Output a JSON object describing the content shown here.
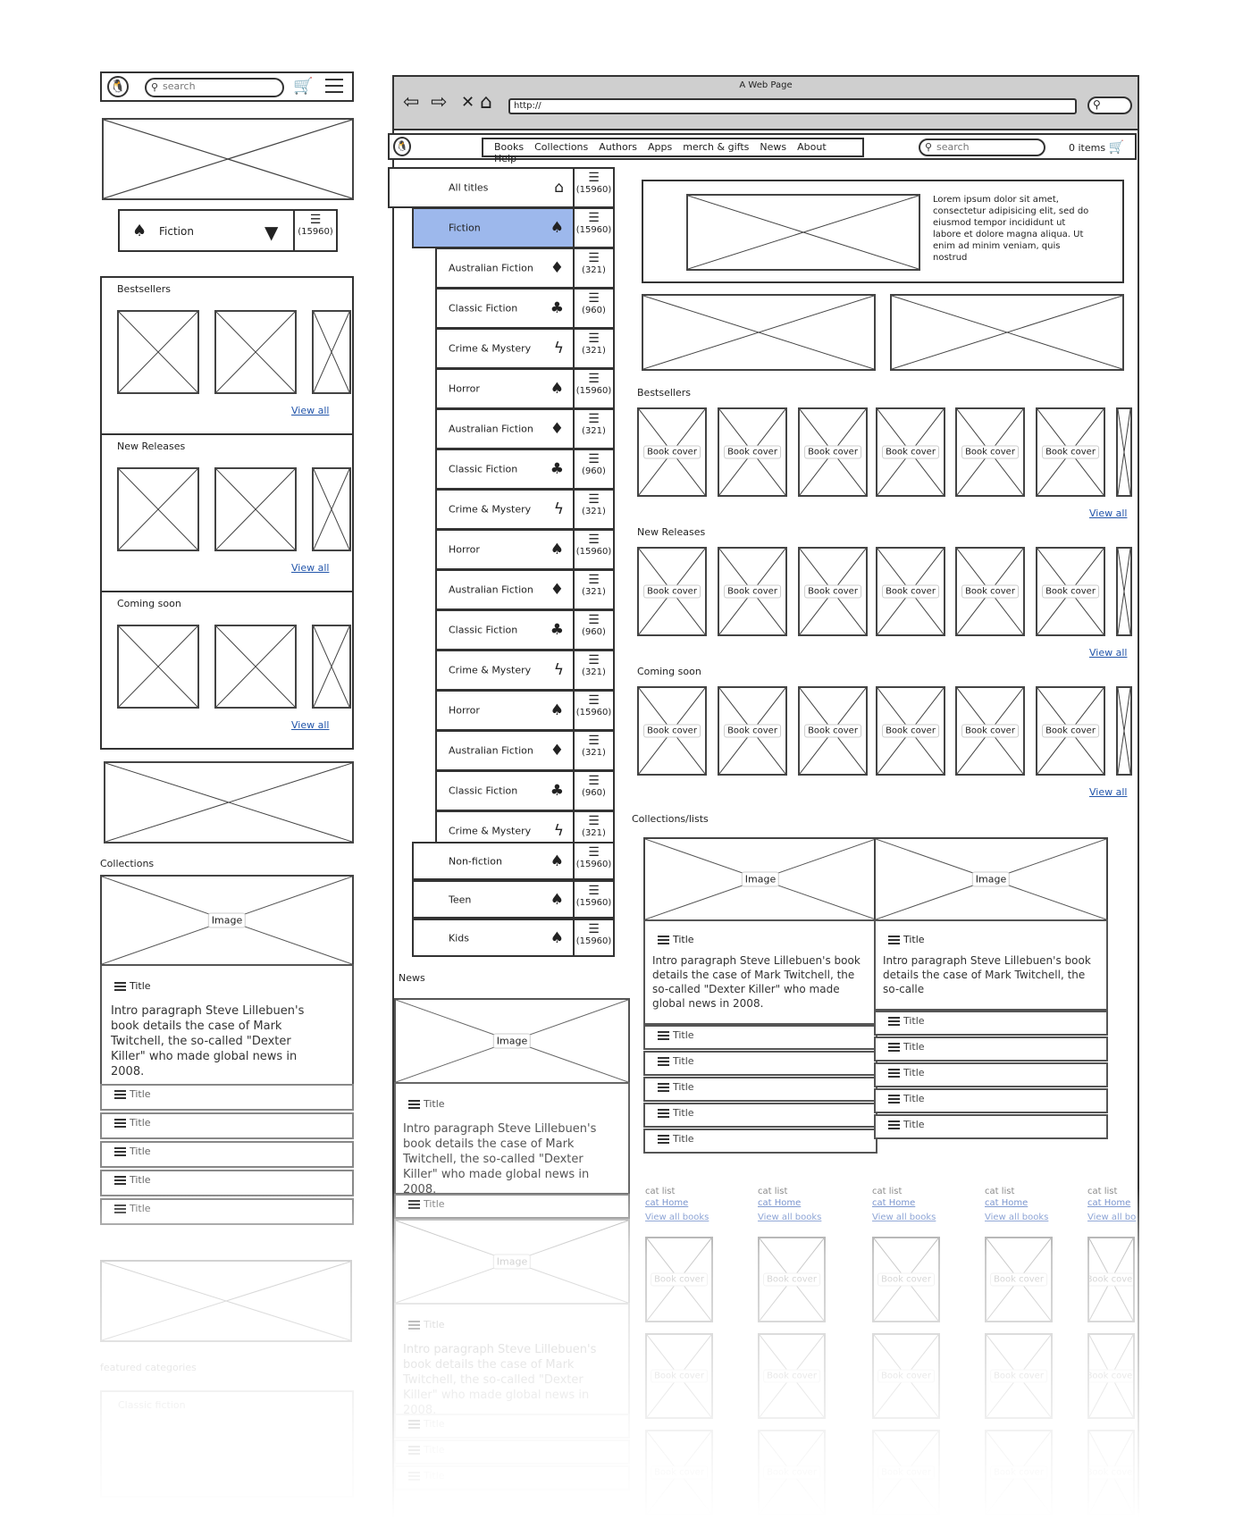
{
  "browser": {
    "window_title": "A Web Page",
    "url": "http://"
  },
  "mobile": {
    "search_placeholder": "search",
    "category_select": "Fiction",
    "category_count": "(15960)",
    "sections": [
      {
        "title": "Bestsellers",
        "view_all": "View all"
      },
      {
        "title": "New Releases",
        "view_all": "View all"
      },
      {
        "title": "Coming soon",
        "view_all": "View all"
      }
    ],
    "collections_heading": "Collections",
    "collection_card": {
      "image_label": "Image",
      "title": "Title",
      "intro": "Intro paragraph Steve Lillebuen's book details the case of Mark Twitchell, the so-called \"Dexter Killer\" who made global news in 2008."
    },
    "collection_titles": [
      "Title",
      "Title",
      "Title",
      "Title",
      "Title"
    ],
    "featured_categories": "featured categories",
    "featured_item": "Classic fiction"
  },
  "desktop": {
    "nav": [
      "Books",
      "Collections",
      "Authors",
      "Apps",
      "merch & gifts",
      "News",
      "About",
      "Help"
    ],
    "search_placeholder": "search",
    "cart_label": "0 items",
    "categories": [
      {
        "name": "All titles",
        "icon": "home-icon",
        "glyph": "⌂",
        "count": "(15960)",
        "level": 0,
        "selected": false
      },
      {
        "name": "Fiction",
        "icon": "spade-icon",
        "glyph": "♠",
        "count": "(15960)",
        "level": 1,
        "selected": true
      },
      {
        "name": "Australian Fiction",
        "icon": "diamond-icon",
        "glyph": "♦",
        "count": "(321)",
        "level": 2,
        "selected": false
      },
      {
        "name": "Classic Fiction",
        "icon": "club-icon",
        "glyph": "♣",
        "count": "(960)",
        "level": 2,
        "selected": false
      },
      {
        "name": "Crime & Mystery",
        "icon": "lightning-icon",
        "glyph": "ϟ",
        "count": "(321)",
        "level": 2,
        "selected": false
      },
      {
        "name": "Horror",
        "icon": "spade-icon",
        "glyph": "♠",
        "count": "(15960)",
        "level": 2,
        "selected": false
      },
      {
        "name": "Australian Fiction",
        "icon": "diamond-icon",
        "glyph": "♦",
        "count": "(321)",
        "level": 2,
        "selected": false
      },
      {
        "name": "Classic Fiction",
        "icon": "club-icon",
        "glyph": "♣",
        "count": "(960)",
        "level": 2,
        "selected": false
      },
      {
        "name": "Crime & Mystery",
        "icon": "lightning-icon",
        "glyph": "ϟ",
        "count": "(321)",
        "level": 2,
        "selected": false
      },
      {
        "name": "Horror",
        "icon": "spade-icon",
        "glyph": "♠",
        "count": "(15960)",
        "level": 2,
        "selected": false
      },
      {
        "name": "Australian Fiction",
        "icon": "diamond-icon",
        "glyph": "♦",
        "count": "(321)",
        "level": 2,
        "selected": false
      },
      {
        "name": "Classic Fiction",
        "icon": "club-icon",
        "glyph": "♣",
        "count": "(960)",
        "level": 2,
        "selected": false
      },
      {
        "name": "Crime & Mystery",
        "icon": "lightning-icon",
        "glyph": "ϟ",
        "count": "(321)",
        "level": 2,
        "selected": false
      },
      {
        "name": "Horror",
        "icon": "spade-icon",
        "glyph": "♠",
        "count": "(15960)",
        "level": 2,
        "selected": false
      },
      {
        "name": "Australian Fiction",
        "icon": "diamond-icon",
        "glyph": "♦",
        "count": "(321)",
        "level": 2,
        "selected": false
      },
      {
        "name": "Classic Fiction",
        "icon": "club-icon",
        "glyph": "♣",
        "count": "(960)",
        "level": 2,
        "selected": false
      },
      {
        "name": "Crime & Mystery",
        "icon": "lightning-icon",
        "glyph": "ϟ",
        "count": "(321)",
        "level": 2,
        "selected": false
      },
      {
        "name": "Non-fiction",
        "icon": "spade-icon",
        "glyph": "♠",
        "count": "(15960)",
        "level": 1,
        "selected": false
      },
      {
        "name": "Teen",
        "icon": "spade-icon",
        "glyph": "♠",
        "count": "(15960)",
        "level": 1,
        "selected": false
      },
      {
        "name": "Kids",
        "icon": "spade-icon",
        "glyph": "♠",
        "count": "(15960)",
        "level": 1,
        "selected": false
      }
    ],
    "hero_text": "Lorem ipsum dolor sit amet, consectetur adipisicing elit, sed do eiusmod tempor incididunt ut labore et dolore magna aliqua. Ut enim ad minim veniam, quis nostrud",
    "book_sections": [
      {
        "title": "Bestsellers",
        "view_all": "View all"
      },
      {
        "title": "New Releases",
        "view_all": "View all"
      },
      {
        "title": "Coming soon",
        "view_all": "View all"
      }
    ],
    "book_cover_label": "Book cover",
    "collections_heading": "Collections/lists",
    "collection_cards": [
      {
        "image_label": "Image",
        "title": "Title",
        "intro": "Intro paragraph Steve Lillebuen's book details the case of Mark Twitchell, the so-called \"Dexter Killer\" who made global news in 2008.",
        "titles": [
          "Title",
          "Title",
          "Title",
          "Title",
          "Title"
        ]
      },
      {
        "image_label": "Image",
        "title": "Title",
        "intro": "Intro paragraph Steve Lillebuen's book details the case of Mark Twitchell, the so-calle",
        "titles": [
          "Title",
          "Title",
          "Title",
          "Title",
          "Title"
        ]
      }
    ],
    "news_heading": "News",
    "news_card": {
      "image_label": "Image",
      "title": "Title",
      "intro": "Intro paragraph Steve Lillebuen's book details the case of Mark Twitchell, the so-called \"Dexter Killer\" who made global news in 2008.",
      "extra_title": "Title"
    },
    "news_card_2": {
      "image_label": "Image",
      "title": "Title",
      "intro": "Intro paragraph Steve Lillebuen's book details the case of Mark Twitchell, the so-called \"Dexter Killer\" who made global news in 2008.",
      "titles": [
        "Title",
        "Title",
        "Title"
      ]
    },
    "cat_lists": [
      {
        "heading": "cat list",
        "home": "cat Home",
        "view_all": "View all books"
      },
      {
        "heading": "cat list",
        "home": "cat Home",
        "view_all": "View all books"
      },
      {
        "heading": "cat list",
        "home": "cat Home",
        "view_all": "View all books"
      },
      {
        "heading": "cat list",
        "home": "cat Home",
        "view_all": "View all books"
      },
      {
        "heading": "cat list",
        "home": "cat Home",
        "view_all": "View all bo"
      }
    ]
  },
  "colors": {
    "selected_category": "#9db8ec",
    "link": "#2255aa",
    "chrome": "#cfcfcf"
  }
}
